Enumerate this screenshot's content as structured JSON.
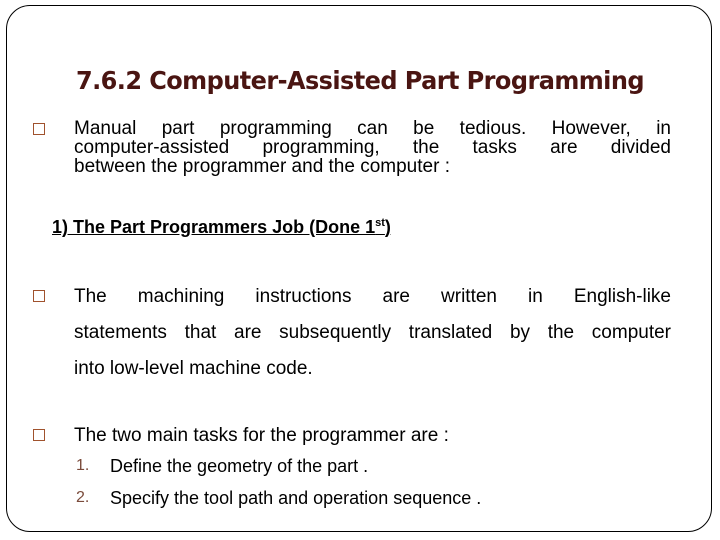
{
  "slide": {
    "title": "7.6.2   Computer-Assisted Part Programming",
    "colors": {
      "title": "#4a1512",
      "bullet_box": "#a0522d",
      "number_marker": "#7a4a3a",
      "frame_border": "#000000"
    },
    "bullets": [
      {
        "icon": "square-bullet-icon",
        "lines": [
          "Manual part programming can be tedious. However, in",
          "computer-assisted programming, the tasks are divided",
          "between the programmer and the computer  :"
        ]
      }
    ],
    "section_heading": {
      "text": "1) The Part Programmers Job (Done 1",
      "superscript": "st",
      "suffix": ")"
    },
    "bullets_section": [
      {
        "icon": "square-bullet-icon",
        "lines": [
          "The machining instructions are written in English-like",
          "statements that are subsequently translated by the computer",
          "into low-level machine code."
        ]
      },
      {
        "icon": "square-bullet-icon",
        "lines": [
          "The two main tasks for the programmer are :"
        ]
      }
    ],
    "numbered_list": [
      {
        "marker": "1.",
        "text": "Define the geometry of the part ."
      },
      {
        "marker": "2.",
        "text": "Specify the tool path and operation sequence ."
      }
    ]
  }
}
